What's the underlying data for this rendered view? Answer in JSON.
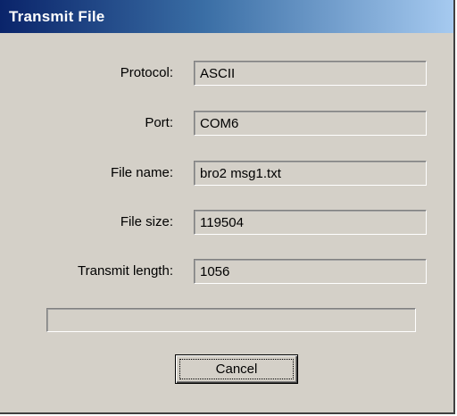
{
  "dialog": {
    "title": "Transmit File"
  },
  "fields": [
    {
      "label": "Protocol:",
      "value": "ASCII"
    },
    {
      "label": "Port:",
      "value": "COM6"
    },
    {
      "label": "File name:",
      "value": "bro2 msg1.txt"
    },
    {
      "label": "File size:",
      "value": "119504"
    },
    {
      "label": "Transmit length:",
      "value": "1056"
    }
  ],
  "progress": {
    "fraction": 0
  },
  "buttons": {
    "cancel_label": "Cancel"
  },
  "colors": {
    "window_face": "#d4d0c8",
    "title_start": "#0a246a",
    "title_end": "#a6caf0",
    "title_text": "#ffffff"
  }
}
